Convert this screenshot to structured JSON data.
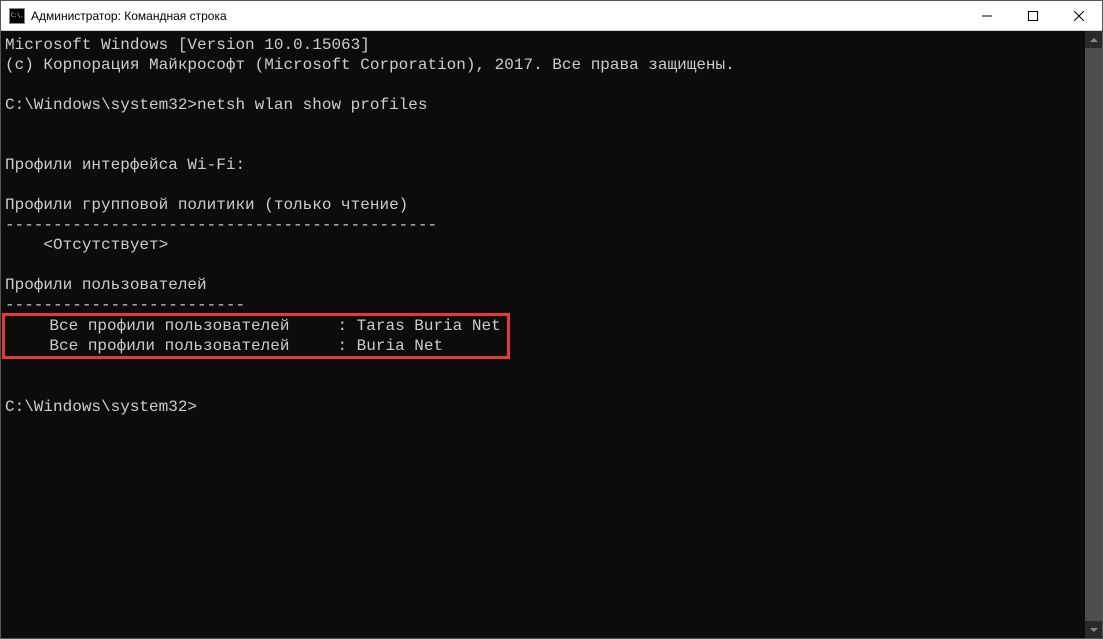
{
  "titlebar": {
    "icon_text": "C:\\.",
    "title": "Администратор: Командная строка"
  },
  "terminal": {
    "line_version": "Microsoft Windows [Version 10.0.15063]",
    "line_copyright": "(c) Корпорация Майкрософт (Microsoft Corporation), 2017. Все права защищены.",
    "prompt1_path": "C:\\Windows\\system32>",
    "prompt1_cmd": "netsh wlan show profiles",
    "heading_interface": "Профили интерфейса Wi-Fi:",
    "heading_group": "Профили групповой политики (только чтение)",
    "dashes_group": "---------------------------------------------",
    "group_none": "    <Отсутствует>",
    "heading_user": "Профили пользователей",
    "dashes_user": "-------------------------",
    "profile1": "    Все профили пользователей     : Taras Buria Net",
    "profile2": "    Все профили пользователей     : Buria Net",
    "prompt2_path": "C:\\Windows\\system32>"
  },
  "colors": {
    "highlight_border": "#e53935"
  }
}
